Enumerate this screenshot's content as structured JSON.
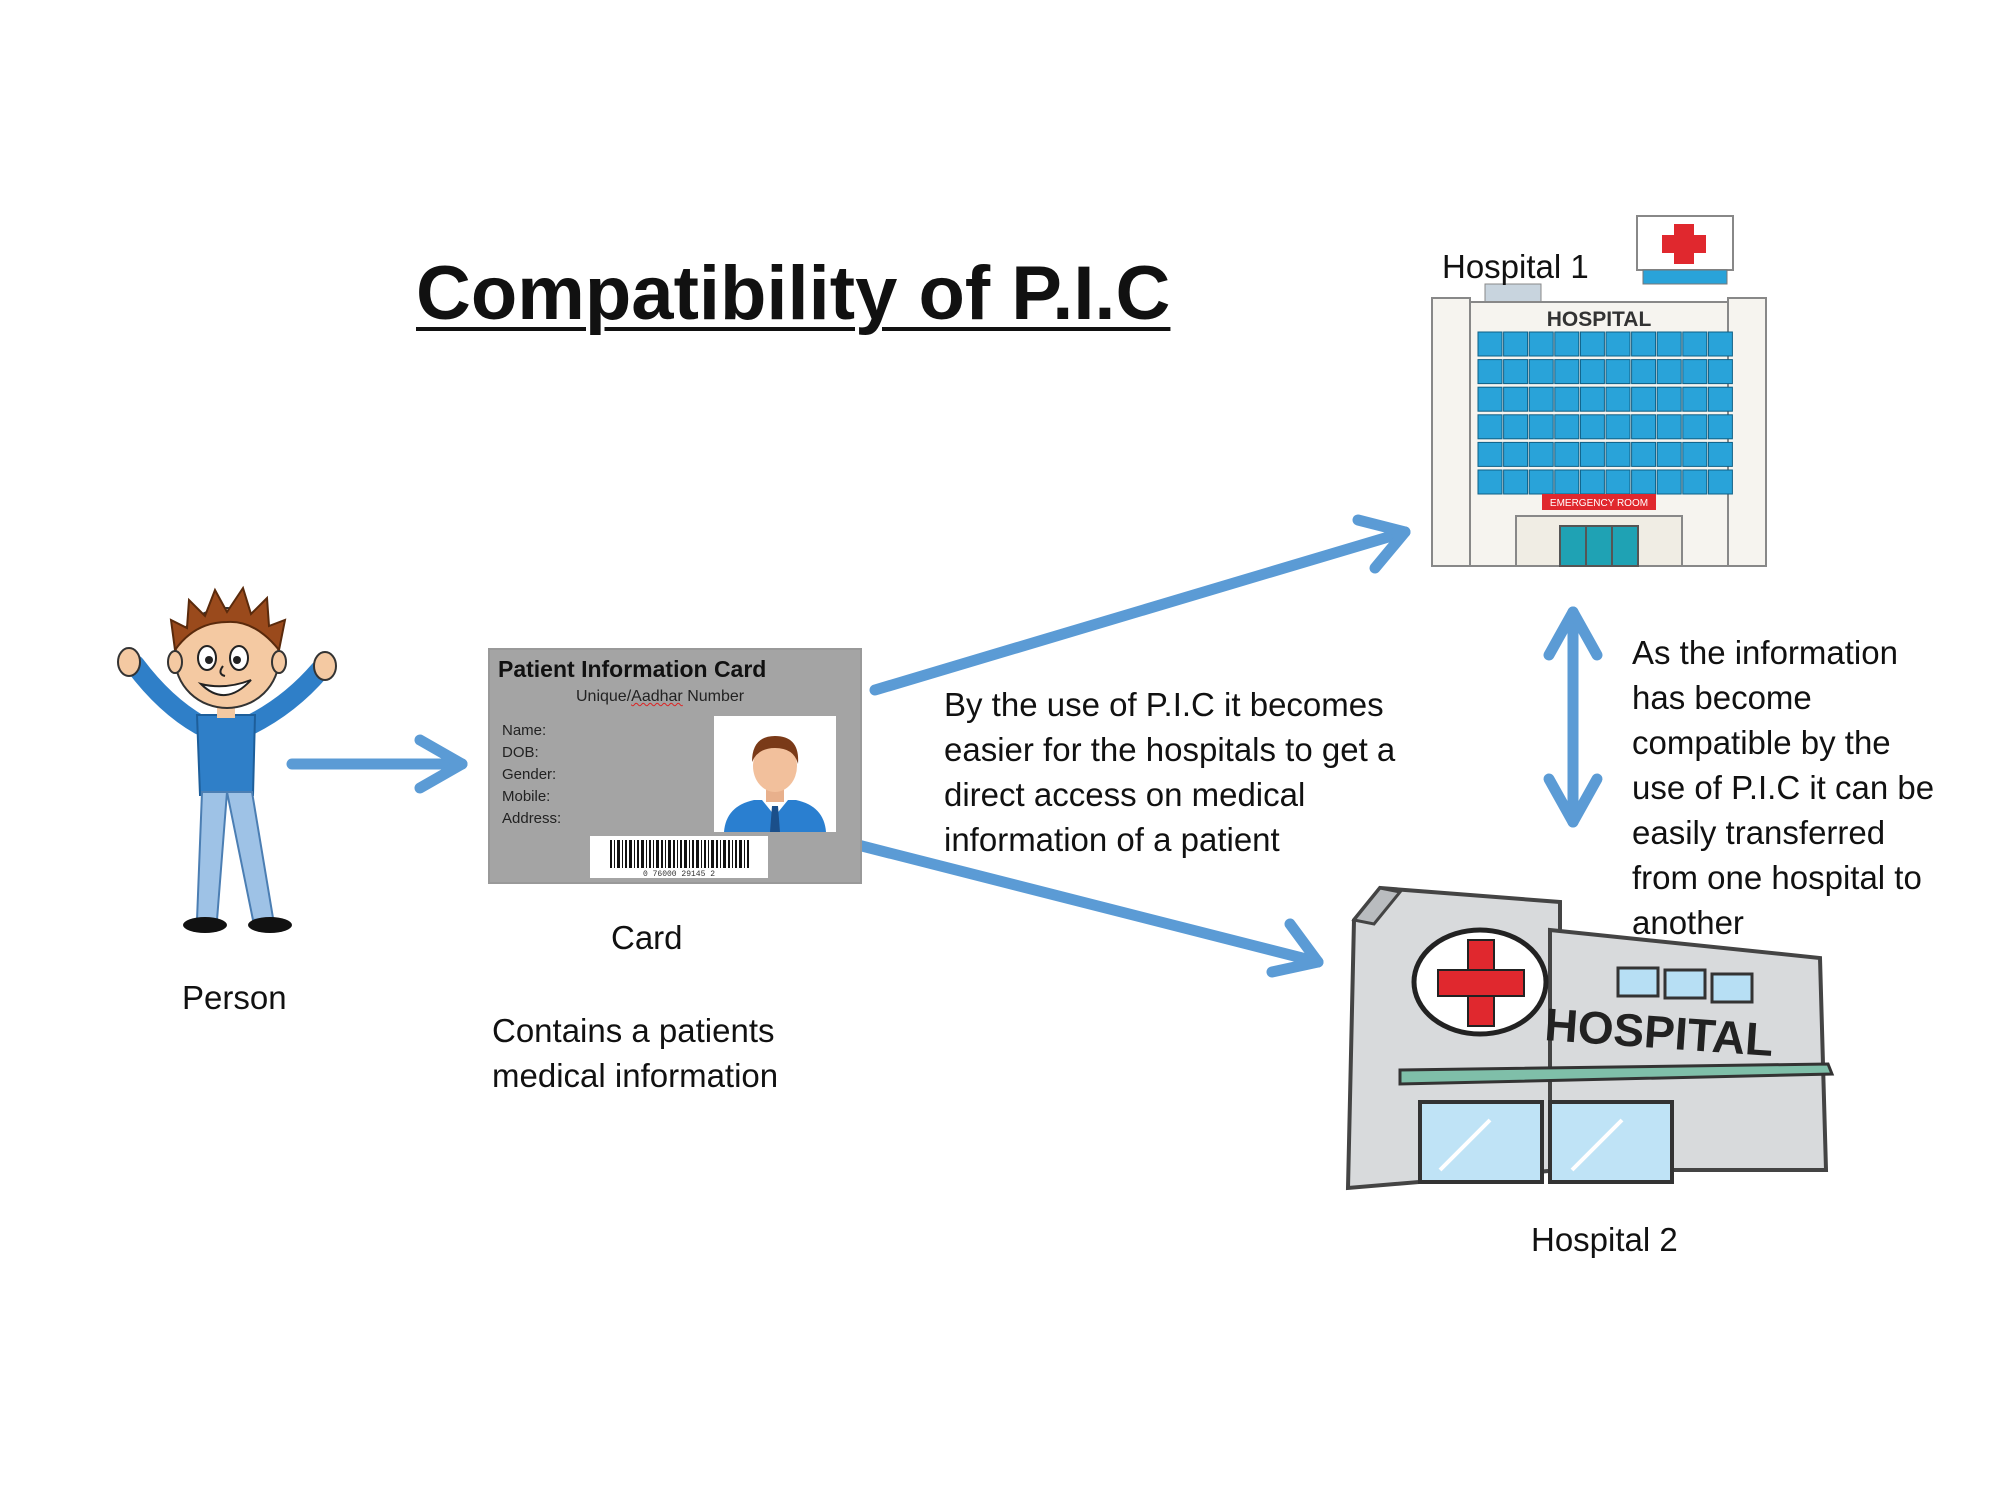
{
  "title": "Compatibility of P.I.C",
  "labels": {
    "person": "Person",
    "card": "Card",
    "hospital1": "Hospital 1",
    "hospital2": "Hospital 2"
  },
  "descriptions": {
    "card": "Contains a patients\nmedical information",
    "access": "By the use of P.I.C it becomes\neasier for the hospitals to get a\ndirect access on medical\ninformation of a patient",
    "transfer": "As the information\nhas become\ncompatible by the\nuse of P.I.C it can be\neasily transferred\nfrom one hospital to\nanother"
  },
  "card": {
    "title": "Patient Information Card",
    "subtitle_prefix": "Unique/",
    "subtitle_underlined": "Aadhar",
    "subtitle_suffix": " Number",
    "fields": [
      "Name:",
      "DOB:",
      "Gender:",
      "Mobile:",
      "Address:"
    ],
    "barcode_number": "0 76000 29145 2"
  },
  "hospital1": {
    "sign": "HOSPITAL",
    "emergency": "EMERGENCY ROOM"
  },
  "hospital2": {
    "sign": "HOSPITAL"
  },
  "colors": {
    "arrow": "#5b9bd5",
    "card_bg": "#a4a4a4",
    "cross": "#e0282e",
    "window_blue": "#29a3d9"
  }
}
